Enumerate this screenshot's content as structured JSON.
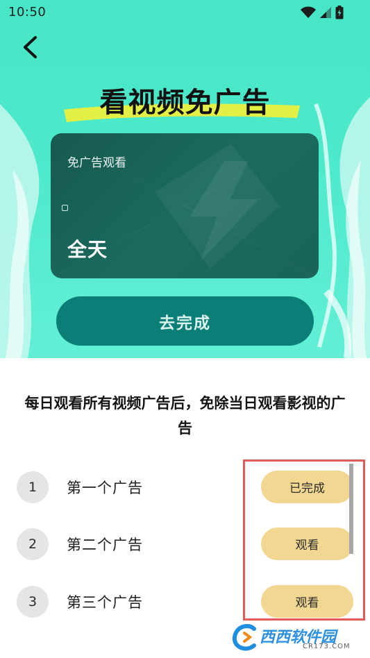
{
  "status_bar": {
    "time": "10:50"
  },
  "header": {
    "back_icon": "chevron-left-icon",
    "title": "看视频免广告"
  },
  "card": {
    "subtitle": "免广告观看",
    "value": "全天"
  },
  "primary_button": {
    "label": "去完成"
  },
  "description": "每日观看所有视频广告后，免除当日观看影视的广告",
  "ads": [
    {
      "number": "1",
      "label": "第一个广告",
      "action": "已完成"
    },
    {
      "number": "2",
      "label": "第二个广告",
      "action": "观看"
    },
    {
      "number": "3",
      "label": "第三个广告",
      "action": "观看"
    }
  ],
  "watermark": {
    "brand": "西西软件园",
    "domain": "CR173.COM"
  },
  "colors": {
    "hero_bg": "#4ee9cb",
    "card_bg": "#1b6a5e",
    "primary_button": "#0b7f77",
    "ad_button": "#f1d791",
    "highlight": "#e05a5a"
  }
}
